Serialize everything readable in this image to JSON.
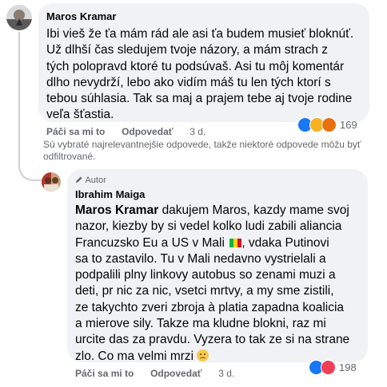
{
  "comment1": {
    "author": "Maros Kramar",
    "lines": [
      "Ibi vieš že ťa mám rád ale asi ťa budem musieť bloknúť.",
      "Už dlhší čas sledujem tvoje názory, a mám strach z",
      "tých polopravd ktoré tu podsúvaš. Asi tu môj komentár",
      "dlho nevydrží, lebo ako vidím máš tu len tých ktorí s",
      "tebou súhlasia. Tak sa maj a prajem tebe aj tvoje rodine",
      "veľa šťastia."
    ],
    "like_label": "Páči sa mi to",
    "reply_label": "Odpovedať",
    "time": "3 d.",
    "reaction_count": "169",
    "reactions": [
      "like-icon",
      "haha-icon",
      "angry-icon"
    ]
  },
  "notice": {
    "line1": "Sú vybraté najrelevantnejšie odpovede, takže niektoré odpovede môžu byť",
    "line2": "odfiltrované."
  },
  "reply": {
    "badge": "Autor",
    "badge_icon": "pencil-icon",
    "author": "Ibrahim Maiga",
    "mention": "Maros Kramar",
    "lines": [
      "dakujem Maros, kazdy mame svoj",
      "nazor, kiezby by si vedel kolko ludi zabili aliancia",
      "Francuzsko Eu a US v Mali",
      ", vdaka Putinovi",
      "sa to zastavilo. Tu v Mali nedavno vystrielali a",
      "podpalili plny linkovy autobus so zenami muzi a",
      "deti, pr nic za nic, vsetci mrtvy, a my sme zistili,",
      "ze takychto zveri zbroja à platia zapadna koalicia",
      "a mierove sily. Takze ma kludne blokni, raz mi",
      "urcite das za pravdu. Vyzera to tak ze si na strane",
      "zlo. Co ma velmi mrzi"
    ],
    "flag_icon": "mali-flag-icon",
    "emoji_icon": "confused-face-icon",
    "like_label": "Páči sa mi to",
    "reply_label": "Odpovedať",
    "time": "3 d.",
    "reaction_count": "198",
    "reactions": [
      "like-icon",
      "love-icon"
    ]
  },
  "colors": {
    "bubble": "#f0f2f5",
    "meta": "#65676b",
    "like": "#1877f2",
    "love": "#f33e58",
    "haha": "#f7b125",
    "angry": "#e9710f",
    "thread_line": "#ced0d4"
  }
}
